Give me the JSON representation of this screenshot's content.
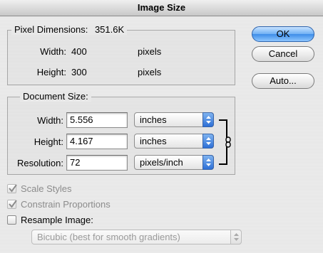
{
  "window": {
    "title": "Image Size"
  },
  "pixel_dimensions": {
    "legend": "Pixel Dimensions:",
    "size": "351.6K",
    "width_label": "Width:",
    "width_value": "400",
    "width_unit": "pixels",
    "height_label": "Height:",
    "height_value": "300",
    "height_unit": "pixels"
  },
  "document_size": {
    "legend": "Document Size:",
    "width_label": "Width:",
    "width_value": "5.556",
    "width_unit": "inches",
    "height_label": "Height:",
    "height_value": "4.167",
    "height_unit": "inches",
    "resolution_label": "Resolution:",
    "resolution_value": "72",
    "resolution_unit": "pixels/inch"
  },
  "options": {
    "scale_styles": {
      "label": "Scale Styles",
      "checked": true,
      "enabled": false
    },
    "constrain_proportions": {
      "label": "Constrain Proportions",
      "checked": true,
      "enabled": false
    },
    "resample_image": {
      "label": "Resample Image:",
      "checked": false,
      "enabled": true
    },
    "resample_method": "Bicubic (best for smooth gradients)"
  },
  "buttons": {
    "ok": "OK",
    "cancel": "Cancel",
    "auto": "Auto..."
  },
  "icons": {
    "link": "chain-link-icon",
    "select_arrow": "up-down-arrows-icon",
    "checkmark": "checkmark-icon"
  },
  "colors": {
    "accent": "#3d8de8",
    "window_bg": "#e8e8e8"
  }
}
